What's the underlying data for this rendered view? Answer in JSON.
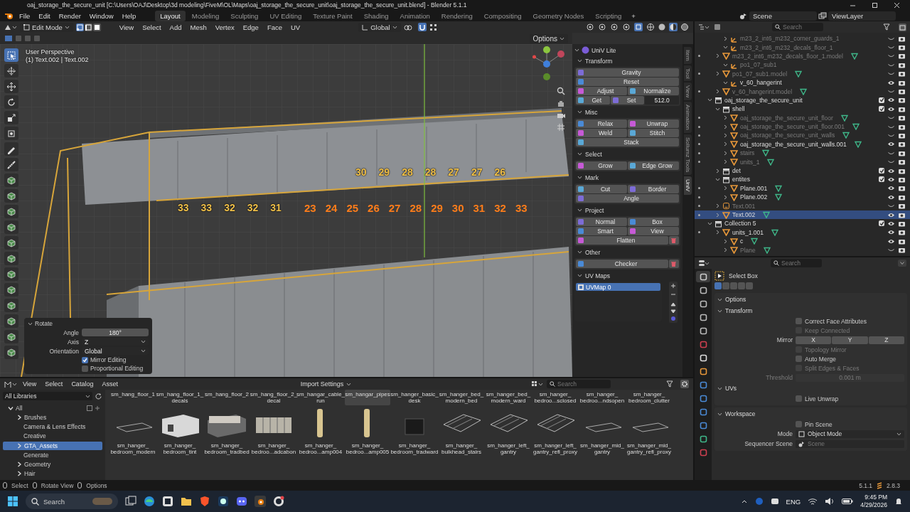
{
  "title_bar": {
    "title": "oaj_storage_the_secure_unit [C:\\Users\\OAJ\\Desktop\\3d modeling\\FiveM\\OL\\Maps\\oaj_storage_the_secure_unit\\oaj_storage_the_secure_unit.blend] - Blender 5.1.1"
  },
  "menu_bar": {
    "menus": [
      "File",
      "Edit",
      "Render",
      "Window",
      "Help"
    ],
    "workspaces": [
      {
        "label": "Layout",
        "selected": true
      },
      {
        "label": "Modeling",
        "selected": false
      },
      {
        "label": "Sculpting",
        "selected": false
      },
      {
        "label": "UV Editing",
        "selected": false
      },
      {
        "label": "Texture Paint",
        "selected": false
      },
      {
        "label": "Shading",
        "selected": false
      },
      {
        "label": "Animation",
        "selected": false
      },
      {
        "label": "Rendering",
        "selected": false
      },
      {
        "label": "Compositing",
        "selected": false
      },
      {
        "label": "Geometry Nodes",
        "selected": false
      },
      {
        "label": "Scripting",
        "selected": false
      }
    ],
    "add_workspace": "+",
    "scene": "Scene",
    "view_layer": "ViewLayer"
  },
  "viewport": {
    "header": {
      "mode": "Edit Mode",
      "select_modes": [
        {
          "kind": "vertex",
          "selected": true
        },
        {
          "kind": "edge",
          "selected": false
        },
        {
          "kind": "face",
          "selected": false
        }
      ],
      "menus": [
        "View",
        "Select",
        "Add",
        "Mesh",
        "Vertex",
        "Edge",
        "Face",
        "UV"
      ],
      "orientation": "Global",
      "options": "Options"
    },
    "tools": [
      {
        "kind": "select",
        "selected": true
      },
      {
        "kind": "cursor",
        "selected": false
      },
      {
        "kind": "move",
        "selected": false
      },
      {
        "kind": "rotate",
        "selected": false
      },
      {
        "kind": "scale",
        "selected": false
      },
      {
        "kind": "transform",
        "selected": false
      },
      {
        "kind": "annotate",
        "selected": false
      },
      {
        "kind": "measure",
        "selected": false
      },
      {
        "kind": "cube",
        "selected": false
      },
      {
        "kind": "cube",
        "selected": false
      },
      {
        "kind": "cube",
        "selected": false
      },
      {
        "kind": "cube",
        "selected": false
      },
      {
        "kind": "cube",
        "selected": false
      },
      {
        "kind": "cube",
        "selected": false
      },
      {
        "kind": "cube",
        "selected": false
      },
      {
        "kind": "cube",
        "selected": false
      },
      {
        "kind": "cube",
        "selected": false
      },
      {
        "kind": "cube",
        "selected": false
      },
      {
        "kind": "cube",
        "selected": false
      },
      {
        "kind": "cube",
        "selected": false
      }
    ],
    "info": [
      "User Perspective",
      "(1) Text.002 | Text.002"
    ],
    "number_rows": [
      {
        "kind": "dim",
        "labels": [
          "30",
          "29",
          "28",
          "28",
          "27",
          "27",
          "26"
        ]
      },
      {
        "kind": "dim",
        "labels": [
          "33",
          "33",
          "32",
          "32",
          "31"
        ]
      },
      {
        "kind": "active",
        "labels": [
          "23",
          "24",
          "25",
          "26",
          "27",
          "28",
          "29",
          "30",
          "31",
          "32",
          "33"
        ]
      }
    ],
    "last_operator": {
      "title": "Rotate",
      "fields": [
        {
          "label": "Angle",
          "value": "180°",
          "kind": "number"
        },
        {
          "label": "Axis",
          "value": "Z",
          "kind": "dropdown"
        },
        {
          "label": "Orientation",
          "value": "Global",
          "kind": "dropdown"
        }
      ],
      "checkboxes": [
        {
          "label": "Mirror Editing",
          "checked": true
        },
        {
          "label": "Proportional Editing",
          "checked": false
        }
      ]
    },
    "sidebar": {
      "title": "UniV Lite",
      "sections": [
        {
          "title": "Transform",
          "rows": [
            {
              "removable": false,
              "items": [
                {
                  "kind": "button",
                  "label": "Gravity"
                }
              ]
            },
            {
              "removable": false,
              "items": [
                {
                  "kind": "button",
                  "label": "Reset"
                }
              ]
            },
            {
              "removable": false,
              "items": [
                {
                  "kind": "button",
                  "label": "Adjust"
                },
                {
                  "kind": "button",
                  "label": "Normalize"
                }
              ]
            },
            {
              "removable": false,
              "items": [
                {
                  "kind": "button",
                  "label": "Get"
                },
                {
                  "kind": "button",
                  "label": "Set"
                },
                {
                  "kind": "field",
                  "label": "512.0"
                }
              ]
            }
          ]
        },
        {
          "title": "Misc",
          "rows": [
            {
              "removable": false,
              "items": [
                {
                  "kind": "button",
                  "label": "Relax"
                },
                {
                  "kind": "button",
                  "label": "Unwrap"
                }
              ]
            },
            {
              "removable": false,
              "items": [
                {
                  "kind": "button",
                  "label": "Weld"
                },
                {
                  "kind": "button",
                  "label": "Stitch"
                }
              ]
            },
            {
              "removable": false,
              "items": [
                {
                  "kind": "button",
                  "label": "Stack"
                }
              ]
            }
          ]
        },
        {
          "title": "Select",
          "rows": [
            {
              "removable": false,
              "items": [
                {
                  "kind": "button",
                  "label": "Grow"
                },
                {
                  "kind": "button",
                  "label": "Edge Grow"
                }
              ]
            }
          ]
        },
        {
          "title": "Mark",
          "rows": [
            {
              "removable": false,
              "items": [
                {
                  "kind": "button",
                  "label": "Cut"
                },
                {
                  "kind": "button",
                  "label": "Border"
                }
              ]
            },
            {
              "removable": false,
              "items": [
                {
                  "kind": "button",
                  "label": "Angle"
                }
              ]
            }
          ]
        },
        {
          "title": "Project",
          "rows": [
            {
              "removable": false,
              "items": [
                {
                  "kind": "button",
                  "label": "Normal"
                },
                {
                  "kind": "button",
                  "label": "Box"
                }
              ]
            },
            {
              "removable": false,
              "items": [
                {
                  "kind": "button",
                  "label": "Smart"
                },
                {
                  "kind": "button",
                  "label": "View"
                }
              ]
            },
            {
              "removable": true,
              "items": [
                {
                  "kind": "button",
                  "label": "Flatten"
                }
              ]
            }
          ]
        },
        {
          "title": "Other",
          "rows": [
            {
              "removable": true,
              "items": [
                {
                  "kind": "button",
                  "label": "Checker"
                }
              ]
            }
          ]
        }
      ],
      "uv_maps_title": "UV Maps",
      "uv_maps": [
        {
          "name": "UVMap 0",
          "selected": true
        }
      ]
    },
    "sidebar_tabs": [
      {
        "label": "Item",
        "selected": false
      },
      {
        "label": "Tool",
        "selected": false
      },
      {
        "label": "View",
        "selected": false
      },
      {
        "label": "Animation",
        "selected": false
      },
      {
        "label": "Sollumz Tools",
        "selected": false
      },
      {
        "label": "UniV",
        "selected": true
      }
    ]
  },
  "outliner": {
    "search": {
      "placeholder": "Search"
    },
    "items": [
      {
        "name": "m23_2_int6_m232_corner_guards_1",
        "kind": "empty",
        "expanded": false,
        "hidden": true,
        "selected": false
      },
      {
        "name": "m23_2_int6_m232_decals_floor_1",
        "kind": "empty",
        "expanded": true,
        "hidden": true,
        "selected": false,
        "children": [
          {
            "name": "m23_2_int6_m232_decals_floor_1.model",
            "kind": "mesh",
            "expanded": false,
            "hidden": true,
            "selected": false
          }
        ]
      },
      {
        "name": "po1_07_sub1",
        "kind": "empty",
        "expanded": true,
        "hidden": true,
        "selected": false,
        "children": [
          {
            "name": "po1_07_sub1.model",
            "kind": "mesh",
            "expanded": false,
            "hidden": true,
            "selected": false
          }
        ]
      },
      {
        "name": "v_60_hangerint",
        "kind": "empty",
        "expanded": true,
        "hidden": false,
        "selected": false,
        "children": [
          {
            "name": "v_60_hangerint.model",
            "kind": "mesh",
            "expanded": false,
            "hidden": true,
            "selected": false
          }
        ]
      },
      {
        "name": "oaj_storage_the_secure_unit",
        "kind": "collection",
        "expanded": true,
        "hidden": false,
        "selected": false,
        "children": [
          {
            "name": "shell",
            "kind": "collection",
            "expanded": true,
            "hidden": false,
            "selected": false,
            "children": [
              {
                "name": "oaj_storage_the_secure_unit_floor",
                "kind": "mesh",
                "expanded": false,
                "hidden": true,
                "selected": false
              },
              {
                "name": "oaj_storage_the_secure_unit_floor.001",
                "kind": "mesh",
                "expanded": false,
                "hidden": true,
                "selected": false
              },
              {
                "name": "oaj_storage_the_secure_unit_walls",
                "kind": "mesh",
                "expanded": false,
                "hidden": true,
                "selected": false
              },
              {
                "name": "oaj_storage_the_secure_unit_walls.001",
                "kind": "mesh",
                "expanded": false,
                "hidden": false,
                "selected": false
              },
              {
                "name": "stairs",
                "kind": "mesh",
                "expanded": false,
                "hidden": true,
                "selected": false
              },
              {
                "name": "units_1",
                "kind": "mesh",
                "expanded": false,
                "hidden": true,
                "selected": false
              }
            ]
          },
          {
            "name": "det",
            "kind": "collection",
            "expanded": false,
            "hidden": false,
            "selected": false
          },
          {
            "name": "entites",
            "kind": "collection",
            "expanded": true,
            "hidden": false,
            "selected": false,
            "children": [
              {
                "name": "Plane.001",
                "kind": "mesh",
                "expanded": false,
                "hidden": false,
                "selected": false
              },
              {
                "name": "Plane.002",
                "kind": "mesh",
                "expanded": false,
                "hidden": false,
                "selected": false
              }
            ]
          },
          {
            "name": "Text.001",
            "kind": "text",
            "expanded": false,
            "hidden": true,
            "selected": false
          },
          {
            "name": "Text.002",
            "kind": "mesh",
            "expanded": false,
            "hidden": false,
            "selected": true
          }
        ]
      },
      {
        "name": "Collection 5",
        "kind": "collection",
        "expanded": true,
        "hidden": false,
        "selected": false,
        "children": [
          {
            "name": "units_1.001",
            "kind": "mesh",
            "expanded": false,
            "hidden": false,
            "selected": false
          }
        ]
      },
      {
        "name": "c",
        "kind": "mesh",
        "expanded": false,
        "hidden": false,
        "selected": false
      },
      {
        "name": "Plane",
        "kind": "mesh",
        "expanded": false,
        "hidden": true,
        "selected": false
      }
    ]
  },
  "properties": {
    "search": {
      "placeholder": "Search"
    },
    "tabs": [
      {
        "kind": "tool",
        "selected": true
      },
      {
        "kind": "render",
        "selected": false
      },
      {
        "kind": "output",
        "selected": false
      },
      {
        "kind": "view_layer",
        "selected": false
      },
      {
        "kind": "scene",
        "selected": false
      },
      {
        "kind": "world",
        "selected": false
      },
      {
        "kind": "collection",
        "selected": false
      },
      {
        "kind": "object",
        "selected": false
      },
      {
        "kind": "modifiers",
        "selected": false
      },
      {
        "kind": "particles",
        "selected": false
      },
      {
        "kind": "physics",
        "selected": false
      },
      {
        "kind": "constraints",
        "selected": false
      },
      {
        "kind": "data",
        "selected": false
      },
      {
        "kind": "material",
        "selected": false
      }
    ],
    "active_tool": "Select Box",
    "tool_modes": [
      {
        "selected": true
      },
      {
        "selected": false
      },
      {
        "selected": false
      },
      {
        "selected": false
      },
      {
        "selected": false
      }
    ],
    "options_title": "Options",
    "transform_title": "Transform",
    "transform_checks_top": [
      {
        "label": "Correct Face Attributes",
        "checked": false,
        "disabled": false
      },
      {
        "label": "Keep Connected",
        "checked": false,
        "disabled": true
      }
    ],
    "mirror": {
      "label": "Mirror",
      "axes": [
        {
          "label": "X",
          "selected": false
        },
        {
          "label": "Y",
          "selected": false
        },
        {
          "label": "Z",
          "selected": false
        }
      ]
    },
    "transform_checks_bottom": [
      {
        "label": "Topology Mirror",
        "checked": false,
        "disabled": true
      },
      {
        "label": "Auto Merge",
        "checked": false,
        "disabled": false
      },
      {
        "label": "Split Edges & Faces",
        "checked": false,
        "disabled": true
      }
    ],
    "threshold": {
      "label": "Threshold",
      "value": "0.001 m",
      "disabled": true
    },
    "uvs_title": "UVs",
    "uv_checks": [
      {
        "label": "Live Unwrap",
        "checked": false,
        "disabled": false
      }
    ],
    "workspace_title": "Workspace",
    "workspace_checks": [
      {
        "label": "Pin Scene",
        "checked": false,
        "disabled": false
      }
    ],
    "mode": {
      "label": "Mode",
      "value": "Object Mode"
    },
    "sequencer_scene": {
      "label": "Sequencer Scene",
      "placeholder": "Scene"
    }
  },
  "asset_browser": {
    "menus": [
      "View",
      "Select",
      "Catalog",
      "Asset"
    ],
    "import_settings": "Import Settings",
    "search": {
      "placeholder": "Search"
    },
    "library": "All Libraries",
    "catalogs": [
      {
        "name": "All",
        "expanded": true,
        "selected": false,
        "children": [
          {
            "name": "Brushes",
            "expanded": false,
            "selected": false
          },
          {
            "name": "Camera & Lens Effects",
            "selected": false
          },
          {
            "name": "Creative",
            "selected": false
          },
          {
            "name": "GTA_Assets",
            "expanded": false,
            "selected": true
          },
          {
            "name": "Generate",
            "selected": false
          },
          {
            "name": "Geometry",
            "expanded": false,
            "selected": false
          },
          {
            "name": "Hair",
            "expanded": false,
            "selected": false
          }
        ]
      }
    ],
    "upper_row": [
      {
        "name": "sm_hang_floor_1",
        "selected": false
      },
      {
        "name": "sm_hang_floor_1_\ndecals",
        "selected": false
      },
      {
        "name": "sm_hang_floor_2",
        "selected": false
      },
      {
        "name": "sm_hang_floor_2_\ndecal",
        "selected": false
      },
      {
        "name": "sm_hangar_cable_\nrun",
        "selected": false
      },
      {
        "name": "sm_hangar_pipes",
        "selected": true
      },
      {
        "name": "sm_hanger_basic_\ndesk",
        "selected": false
      },
      {
        "name": "sm_hanger_bed_\nmodern_bed",
        "selected": false
      },
      {
        "name": "sm_hanger_bed_\nmodern_ward",
        "selected": false
      },
      {
        "name": "sm_hanger_\nbedroo...sclosed",
        "selected": false
      },
      {
        "name": "sm_hanger_\nbedroo...ndsopen",
        "selected": false
      },
      {
        "name": "sm_hanger_\nbedroom_clutter",
        "selected": false
      }
    ],
    "assets": [
      {
        "name": "sm_hanger_\nbedroom_modern",
        "kind": "flat"
      },
      {
        "name": "sm_hanger_\nbedroom_tint",
        "kind": "room"
      },
      {
        "name": "sm_hanger_\nbedroom_tradbed",
        "kind": "bed"
      },
      {
        "name": "sm_hanger_\nbedroo...adcabon",
        "kind": "cabinet"
      },
      {
        "name": "sm_hanger_\nbedroo...amp004",
        "kind": "lamp"
      },
      {
        "name": "sm_hanger_\nbedroo...amp005",
        "kind": "lamp"
      },
      {
        "name": "sm_hanger_\nbedroom_tradward",
        "kind": "box"
      },
      {
        "name": "sm_hanger_\nbulkhead_stairs",
        "kind": "frame"
      },
      {
        "name": "sm_hanger_left_\ngantry",
        "kind": "frame"
      },
      {
        "name": "sm_hanger_left_\ngantry_refl_proxy",
        "kind": "frame"
      },
      {
        "name": "sm_hanger_mid_\ngantry",
        "kind": "flat"
      },
      {
        "name": "sm_hanger_mid_\ngantry_refl_proxy",
        "kind": "flat"
      }
    ]
  },
  "status_bar": {
    "hints": [
      "Select",
      "Rotate View",
      "Options"
    ],
    "version": "5.1.1",
    "addon_version": "2.8.3"
  },
  "taskbar": {
    "search": {
      "placeholder": "Search"
    },
    "language": "ENG",
    "time": "9:45 PM",
    "date": "4/29/2026"
  }
}
